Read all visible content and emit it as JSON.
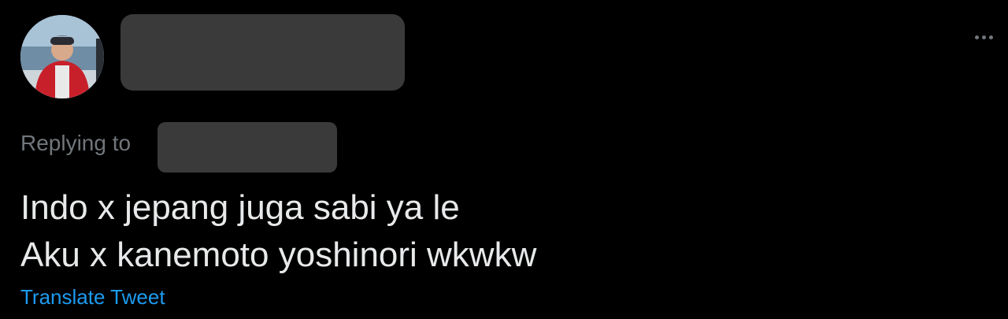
{
  "tweet": {
    "avatar_icon": "user-avatar",
    "more_icon": "more-horizontal-icon",
    "replying_prefix": "Replying to",
    "text_lines": [
      "Indo x jepang juga sabi ya le",
      "Aku x kanemoto yoshinori wkwkw"
    ],
    "translate_label": "Translate Tweet"
  },
  "colors": {
    "background": "#000000",
    "text_primary": "#e7e9ea",
    "text_secondary": "#71767b",
    "link": "#1d9bf0",
    "redaction": "#3a3a3a"
  }
}
